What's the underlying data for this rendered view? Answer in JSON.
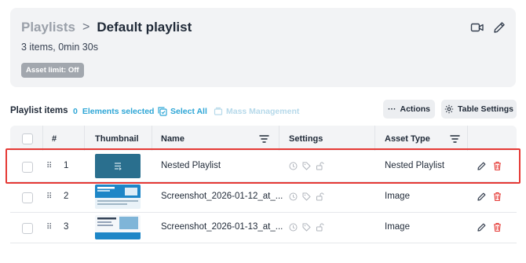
{
  "header": {
    "breadcrumb_root": "Playlists",
    "breadcrumb_separator": ">",
    "title": "Default playlist",
    "summary": "3 items, 0min 30s",
    "badge": "Asset limit: Off",
    "icons": [
      "video-camera-icon",
      "pencil-icon"
    ]
  },
  "toolbar": {
    "section_title": "Playlist items",
    "selected_count": "0",
    "selected_label": "Elements selected",
    "select_all": "Select All",
    "mass_management": "Mass Management",
    "actions_label": "Actions",
    "actions_prefix": "···",
    "table_settings_label": "Table Settings"
  },
  "table": {
    "columns": [
      "#",
      "Thumbnail",
      "Name",
      "Settings",
      "Asset Type"
    ],
    "rows": [
      {
        "index": "1",
        "name": "Nested Playlist",
        "asset_type": "Nested Playlist",
        "thumb": "playlist-thumbnail",
        "selected": false
      },
      {
        "index": "2",
        "name": "Screenshot_2026-01-12_at_...",
        "asset_type": "Image",
        "thumb": "screenshot-thumbnail",
        "selected": false
      },
      {
        "index": "3",
        "name": "Screenshot_2026-01-13_at_...",
        "asset_type": "Image",
        "thumb": "screenshot-thumbnail",
        "selected": false
      }
    ]
  },
  "colors": {
    "accent": "#2ea6d6",
    "delete": "#e53935",
    "highlight": "#e53935",
    "header_bg": "#f2f3f5"
  }
}
